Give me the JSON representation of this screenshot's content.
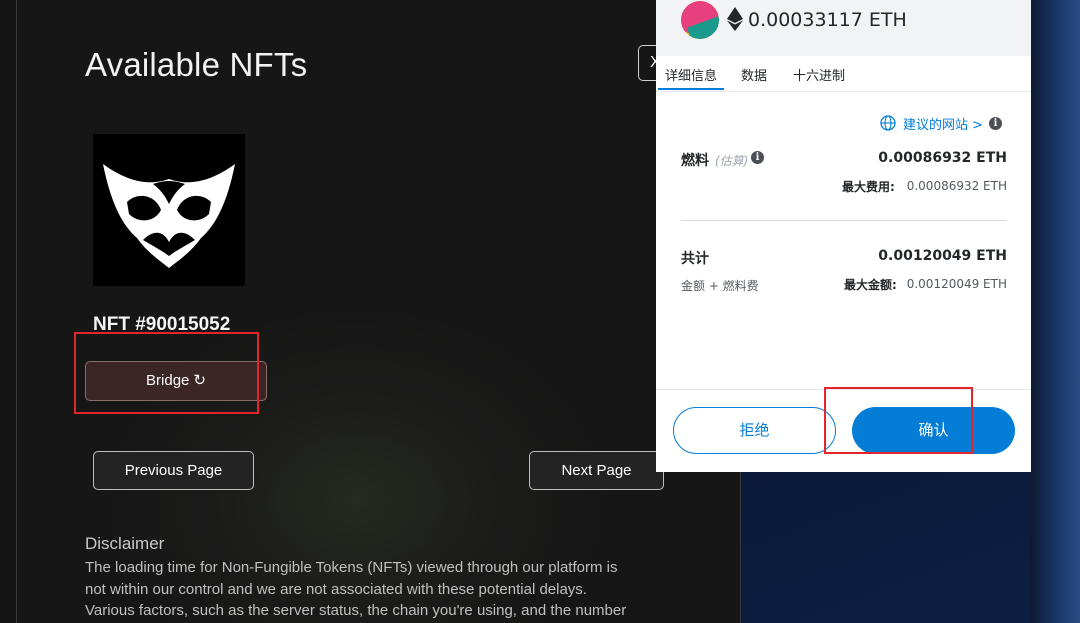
{
  "dapp": {
    "title": "Available NFTs",
    "close_label": "X",
    "nft": {
      "name": "NFT #90015052"
    },
    "bridge_label": "Bridge",
    "prev_label": "Previous Page",
    "next_label": "Next Page",
    "disclaimer_title": "Disclaimer",
    "disclaimer_lines": [
      "The loading time for Non-Fungible Tokens (NFTs) viewed through our platform is",
      "not within our control and we are not associated with these potential delays.",
      "Various factors, such as the server status, the chain you're using, and the number"
    ]
  },
  "metamask": {
    "amount": "0.00033117 ETH",
    "tabs": [
      "详细信息",
      "数据",
      "十六进制"
    ],
    "active_tab": "详细信息",
    "suggested_site": "建议的网站 >",
    "gas_label": "燃料",
    "gas_estimate_tag": "(估算)",
    "gas_value": "0.00086932 ETH",
    "max_fee_label": "最大费用:",
    "max_fee_value": "0.00086932 ETH",
    "total_label": "共计",
    "total_value": "0.00120049 ETH",
    "total_sub": "金额 + 燃料费",
    "max_amount_label": "最大金额:",
    "max_amount_value": "0.00120049 ETH",
    "reject_label": "拒绝",
    "confirm_label": "确认"
  },
  "colors": {
    "accent_blue": "#037dd6",
    "highlight_red": "#e3262b",
    "bridge_bg": "#3b2525"
  }
}
